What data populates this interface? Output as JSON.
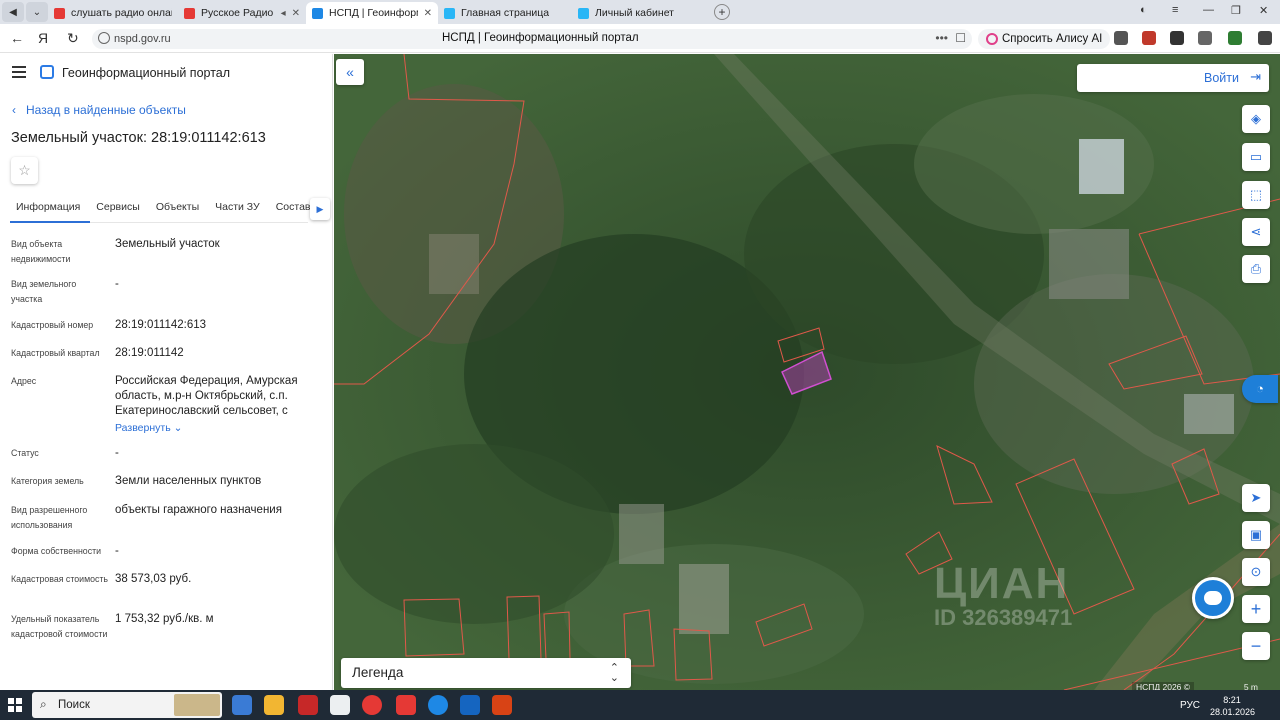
{
  "browser": {
    "tabs": [
      {
        "label": "слушать радио онлайн бе",
        "color": "#e53935"
      },
      {
        "label": "Русское Радио — сл",
        "color": "#e53935"
      },
      {
        "label": "НСПД | Геоинформаци",
        "color": "#1e88e5",
        "active": true
      },
      {
        "label": "Главная страница",
        "color": "#29b6f6"
      },
      {
        "label": "Личный кабинет",
        "color": "#29b6f6"
      }
    ],
    "url": "nspd.gov.ru",
    "page_title": "НСПД | Геоинформационный портал",
    "alice_label": "Спросить Алису AI"
  },
  "panel": {
    "portal_title": "Геоинформационный портал",
    "back_label": "Назад в найденные объекты",
    "object_title": "Земельный участок: 28:19:011142:613",
    "tabs": [
      "Информация",
      "Сервисы",
      "Объекты",
      "Части ЗУ",
      "Состав"
    ],
    "fields": [
      {
        "label": "Вид объекта недвижимости",
        "value": "Земельный участок"
      },
      {
        "label": "Вид земельного участка",
        "value": "-"
      },
      {
        "label": "Кадастровый номер",
        "value": "28:19:011142:613"
      },
      {
        "label": "Кадастровый квартал",
        "value": "28:19:011142"
      },
      {
        "label": "Адрес",
        "value": "Российская Федерация, Амурская область, м.р-н Октябрьский, с.п. Екатеринославский сельсовет, с"
      },
      {
        "label": "Статус",
        "value": "-"
      },
      {
        "label": "Категория земель",
        "value": "Земли населенных пунктов"
      },
      {
        "label": "Вид разрешенного использования",
        "value": "объекты гаражного назначения"
      },
      {
        "label": "Форма собственности",
        "value": "-"
      },
      {
        "label": "Кадастровая стоимость",
        "value": "38 573,03 руб."
      },
      {
        "label": "Удельный показатель кадастровой стоимости",
        "value": "1 753,32 руб./кв. м"
      }
    ],
    "expand_label": "Развернуть"
  },
  "map": {
    "login_label": "Войти",
    "legend_label": "Легенда",
    "watermark_main": "ЦИАН",
    "watermark_id": "ID 326389471",
    "footer_note": "НСПД 2026 ©",
    "scale_label": "5 m"
  },
  "taskbar": {
    "search_label": "Поиск",
    "lang": "РУС",
    "time": "8:21",
    "date": "28.01.2026"
  },
  "colors": {
    "accent": "#2c6fd6",
    "parcel_outline": "#e0594a",
    "selected_parcel": "#c040c0"
  }
}
